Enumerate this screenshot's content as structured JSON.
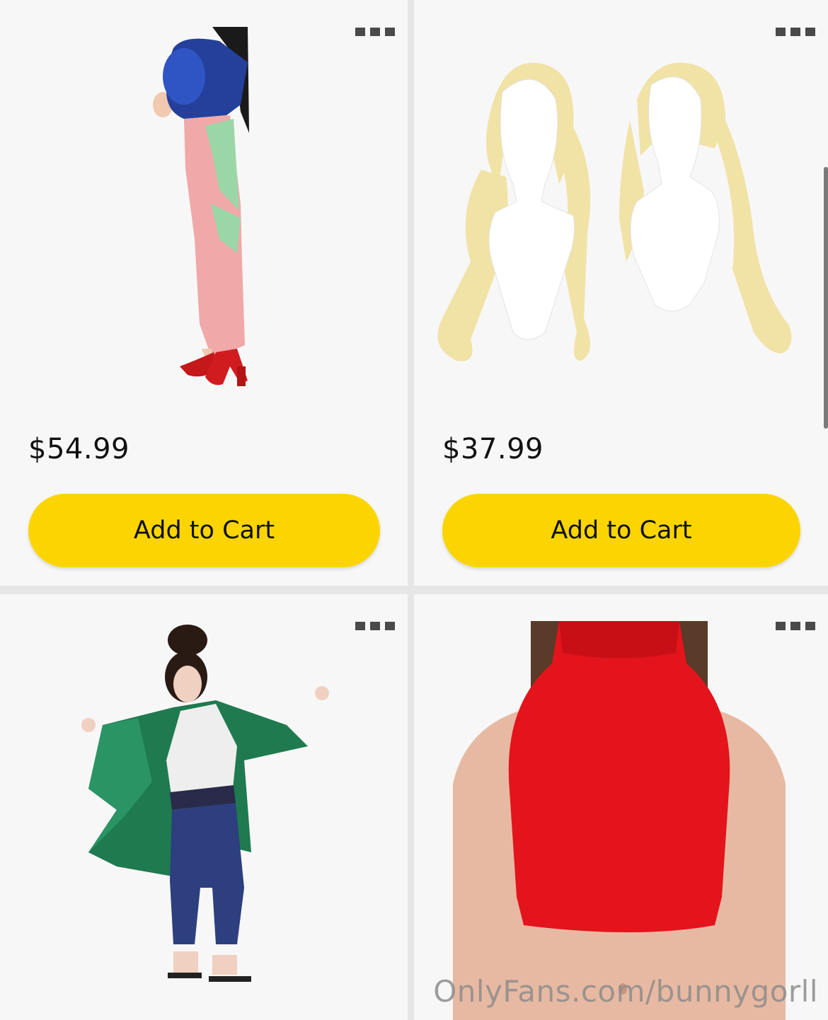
{
  "products": [
    {
      "price": "$54.99",
      "cart_label": "Add to Cart",
      "image": "pink-green-dress-costume"
    },
    {
      "price": "$37.99",
      "cart_label": "Add to Cart",
      "image": "blonde-long-wig"
    },
    {
      "image": "green-coat-ninja-costume"
    },
    {
      "image": "red-sleeveless-crop-top"
    }
  ],
  "more_icon": "more-dots-icon",
  "watermark": "OnlyFans.com/bunnygorll",
  "colors": {
    "button": "#fcd500",
    "card": "#f7f7f7",
    "divider": "#e6e6e6"
  }
}
